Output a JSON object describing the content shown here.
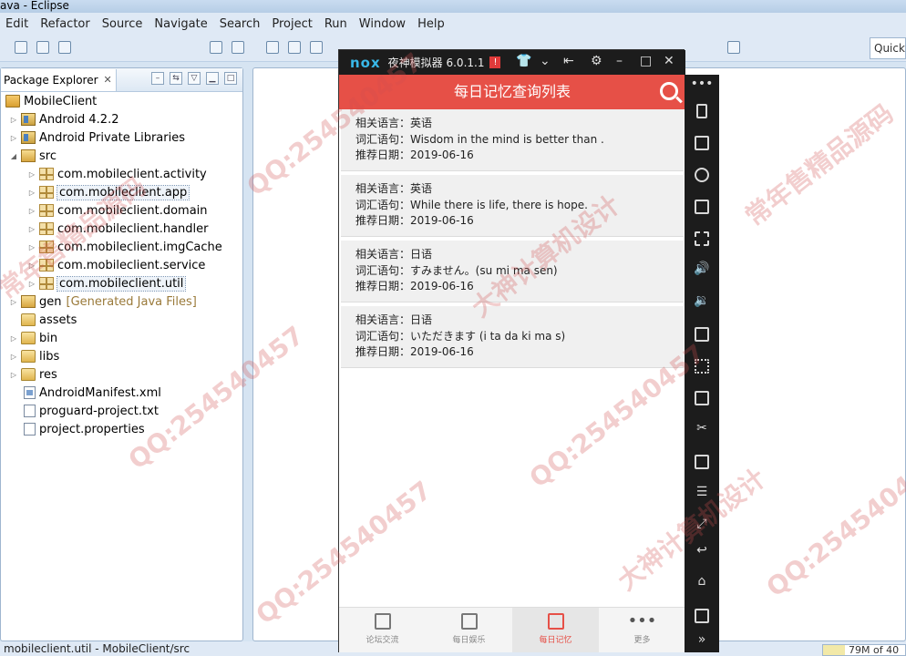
{
  "window": {
    "title": "ava - Eclipse"
  },
  "menu": [
    "Edit",
    "Refactor",
    "Source",
    "Navigate",
    "Search",
    "Project",
    "Run",
    "Window",
    "Help"
  ],
  "toolbar": {
    "quick_access": "Quick"
  },
  "package_explorer": {
    "tab_label": "Package Explorer",
    "items": [
      {
        "label": "MobileClient",
        "extra": ""
      },
      {
        "label": "Android 4.2.2",
        "extra": ""
      },
      {
        "label": "Android Private Libraries",
        "extra": ""
      },
      {
        "label": "src",
        "extra": ""
      },
      {
        "label": "com.mobileclient.activity",
        "extra": ""
      },
      {
        "label": "com.mobileclient.app",
        "extra": ""
      },
      {
        "label": "com.mobileclient.domain",
        "extra": ""
      },
      {
        "label": "com.mobileclient.handler",
        "extra": ""
      },
      {
        "label": "com.mobileclient.imgCache",
        "extra": ""
      },
      {
        "label": "com.mobileclient.service",
        "extra": ""
      },
      {
        "label": "com.mobileclient.util",
        "extra": ""
      },
      {
        "label": "gen",
        "extra": "[Generated Java Files]"
      },
      {
        "label": "assets",
        "extra": ""
      },
      {
        "label": "bin",
        "extra": ""
      },
      {
        "label": "libs",
        "extra": ""
      },
      {
        "label": "res",
        "extra": ""
      },
      {
        "label": "AndroidManifest.xml",
        "extra": ""
      },
      {
        "label": "proguard-project.txt",
        "extra": ""
      },
      {
        "label": "project.properties",
        "extra": ""
      }
    ]
  },
  "status": {
    "left": "mobileclient.util - MobileClient/src",
    "memory": "79M of 40"
  },
  "emulator": {
    "logo": "nox",
    "name": "夜神模拟器 6.0.1.1",
    "badge": "!"
  },
  "app": {
    "title": "每日记忆查询列表",
    "cards": [
      {
        "lang": "相关语言：英语",
        "phrase": "词汇语句：Wisdom in the mind is better than ...",
        "date": "推荐日期：2019-06-16"
      },
      {
        "lang": "相关语言：英语",
        "phrase": "词汇语句：While there is life, there is hope.",
        "date": "推荐日期：2019-06-16"
      },
      {
        "lang": "相关语言：日语",
        "phrase": "词汇语句：すみません。(su mi ma sen)",
        "date": "推荐日期：2019-06-16"
      },
      {
        "lang": "相关语言：日语",
        "phrase": "词汇语句：いただきます (i ta da ki ma s)",
        "date": "推荐日期：2019-06-16"
      }
    ],
    "tabs": [
      {
        "label": "论坛交流",
        "active": false
      },
      {
        "label": "每日娱乐",
        "active": false
      },
      {
        "label": "每日记忆",
        "active": true
      },
      {
        "label": "更多",
        "active": false
      }
    ]
  },
  "watermarks": [
    "QQ:254540457",
    "常年售精品源码",
    "大神计算机设计"
  ],
  "colors": {
    "accent": "#e65047",
    "emulator_bg": "#1c1c1c"
  }
}
